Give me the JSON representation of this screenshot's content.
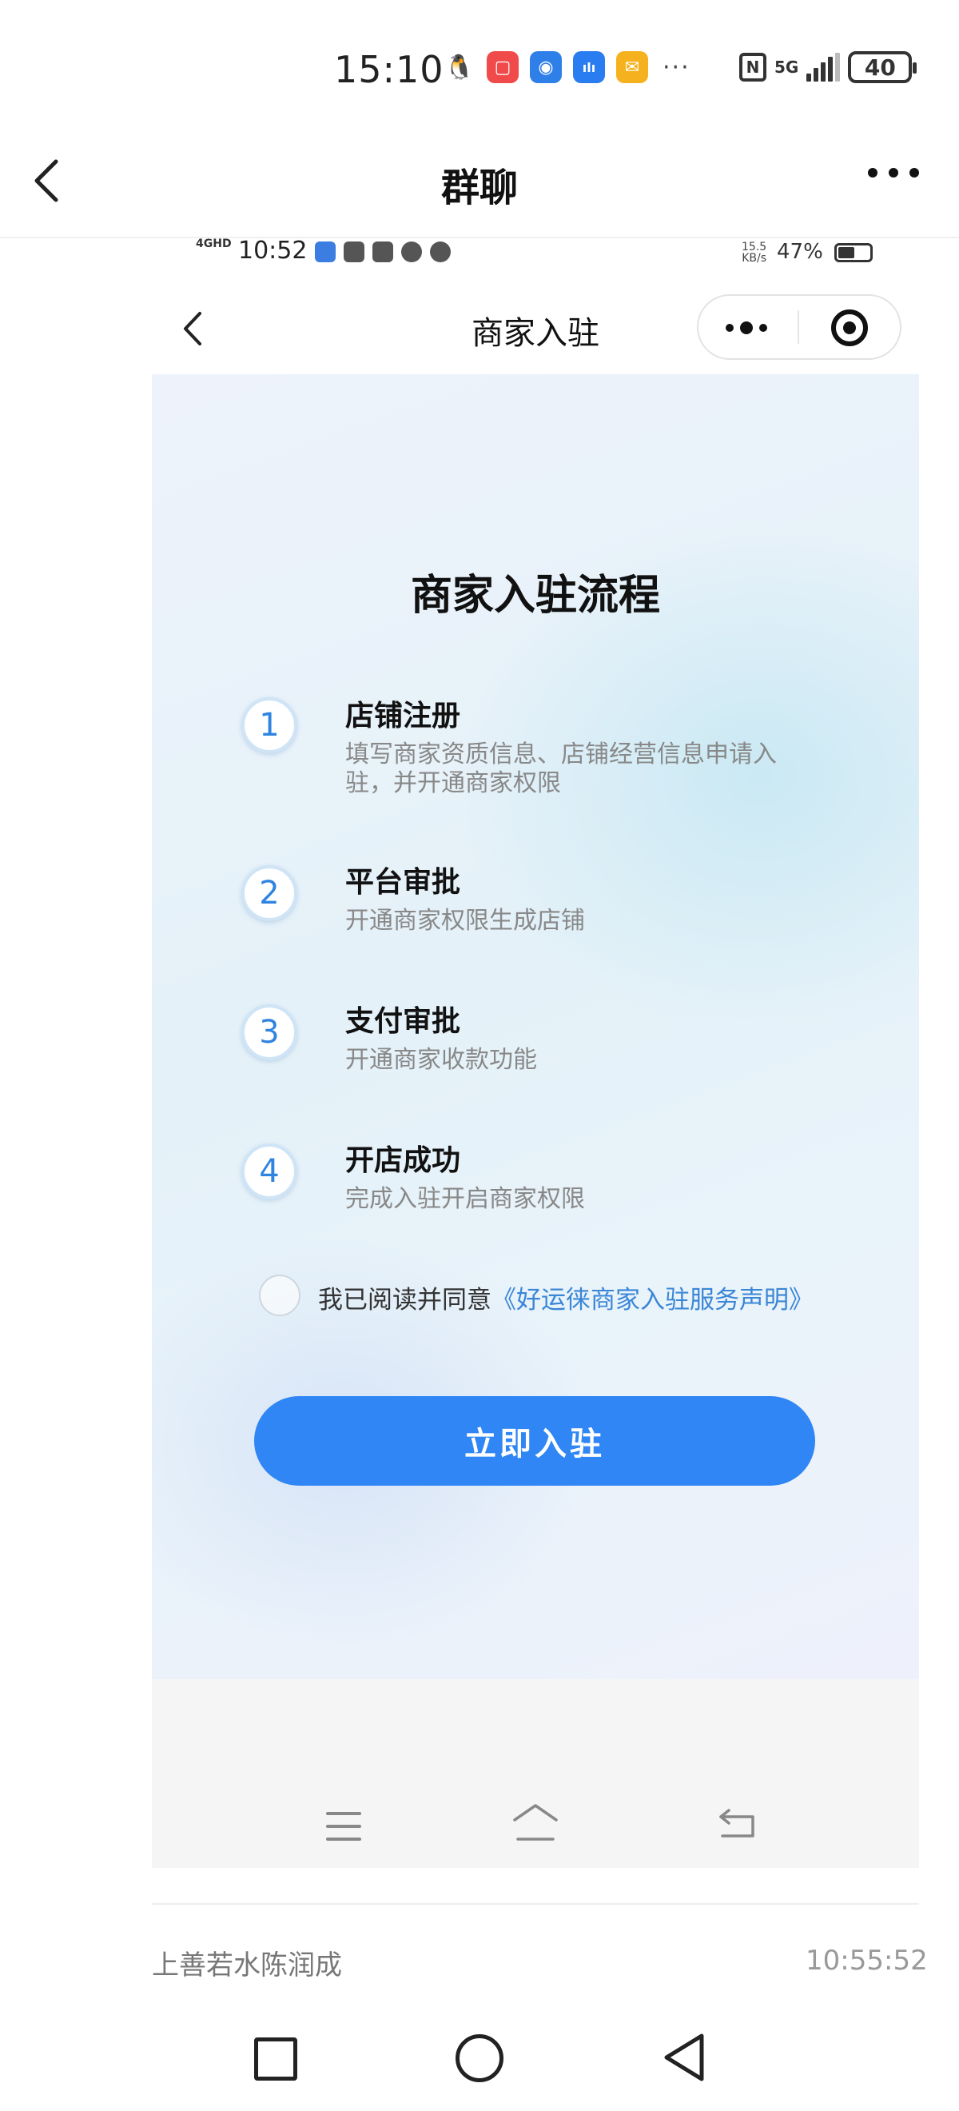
{
  "status_bar": {
    "time": "15:10",
    "network": "5G",
    "battery": "40",
    "more": "···",
    "app_icons": [
      {
        "name": "qq-icon",
        "color": "#ffffff",
        "glyph": "🐧"
      },
      {
        "name": "red-app-icon",
        "color": "#f14a4a",
        "glyph": "▢"
      },
      {
        "name": "blue-app-icon",
        "color": "#2f7fe8",
        "glyph": "◉"
      },
      {
        "name": "voice-app-icon",
        "color": "#2a7df0",
        "glyph": "ılı"
      },
      {
        "name": "mail-icon",
        "color": "#f5b21e",
        "glyph": "✉"
      }
    ]
  },
  "header": {
    "title": "群聊"
  },
  "inner_status": {
    "time": "10:52",
    "network": "4GHD",
    "speed": "15.5\nKB/s",
    "battery_pct": "47%"
  },
  "miniapp_header": {
    "title": "商家入驻"
  },
  "process": {
    "title": "商家入驻流程",
    "steps": [
      {
        "number": "1",
        "title": "店铺注册",
        "desc": "填写商家资质信息、店铺经营信息申请入驻，并开通商家权限"
      },
      {
        "number": "2",
        "title": "平台审批",
        "desc": "开通商家权限生成店铺"
      },
      {
        "number": "3",
        "title": "支付审批",
        "desc": "开通商家收款功能"
      },
      {
        "number": "4",
        "title": "开店成功",
        "desc": "完成入驻开启商家权限"
      }
    ]
  },
  "agreement": {
    "prefix": "我已阅读并同意",
    "link": "《好运徕商家入驻服务声明》",
    "checked": false
  },
  "cta": {
    "label": "立即入驻"
  },
  "message": {
    "sender": "上善若水陈润成",
    "time": "10:55:52"
  },
  "colors": {
    "primary": "#2f86f4",
    "link": "#3a86d6",
    "step_number": "#2f84e0"
  }
}
